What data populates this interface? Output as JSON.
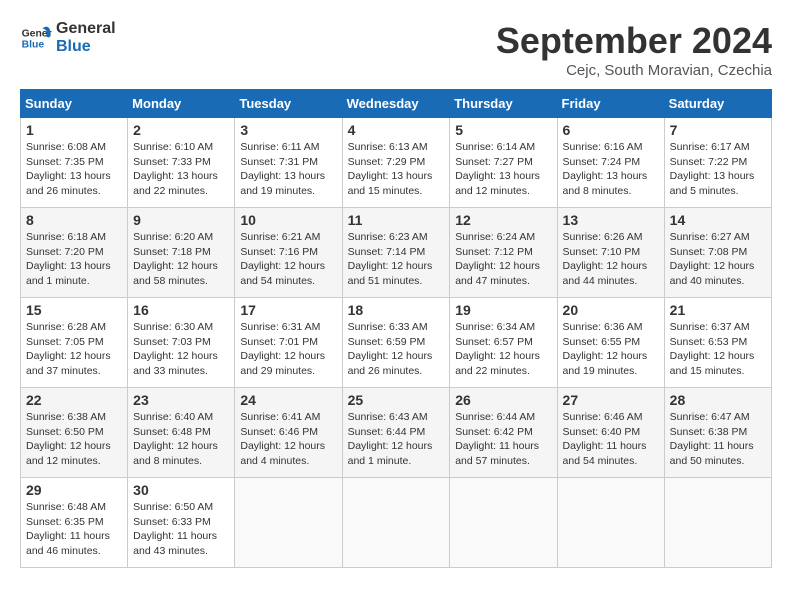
{
  "header": {
    "logo_line1": "General",
    "logo_line2": "Blue",
    "title": "September 2024",
    "location": "Cejc, South Moravian, Czechia"
  },
  "weekdays": [
    "Sunday",
    "Monday",
    "Tuesday",
    "Wednesday",
    "Thursday",
    "Friday",
    "Saturday"
  ],
  "weeks": [
    [
      {
        "day": "1",
        "info": "Sunrise: 6:08 AM\nSunset: 7:35 PM\nDaylight: 13 hours\nand 26 minutes."
      },
      {
        "day": "2",
        "info": "Sunrise: 6:10 AM\nSunset: 7:33 PM\nDaylight: 13 hours\nand 22 minutes."
      },
      {
        "day": "3",
        "info": "Sunrise: 6:11 AM\nSunset: 7:31 PM\nDaylight: 13 hours\nand 19 minutes."
      },
      {
        "day": "4",
        "info": "Sunrise: 6:13 AM\nSunset: 7:29 PM\nDaylight: 13 hours\nand 15 minutes."
      },
      {
        "day": "5",
        "info": "Sunrise: 6:14 AM\nSunset: 7:27 PM\nDaylight: 13 hours\nand 12 minutes."
      },
      {
        "day": "6",
        "info": "Sunrise: 6:16 AM\nSunset: 7:24 PM\nDaylight: 13 hours\nand 8 minutes."
      },
      {
        "day": "7",
        "info": "Sunrise: 6:17 AM\nSunset: 7:22 PM\nDaylight: 13 hours\nand 5 minutes."
      }
    ],
    [
      {
        "day": "8",
        "info": "Sunrise: 6:18 AM\nSunset: 7:20 PM\nDaylight: 13 hours\nand 1 minute."
      },
      {
        "day": "9",
        "info": "Sunrise: 6:20 AM\nSunset: 7:18 PM\nDaylight: 12 hours\nand 58 minutes."
      },
      {
        "day": "10",
        "info": "Sunrise: 6:21 AM\nSunset: 7:16 PM\nDaylight: 12 hours\nand 54 minutes."
      },
      {
        "day": "11",
        "info": "Sunrise: 6:23 AM\nSunset: 7:14 PM\nDaylight: 12 hours\nand 51 minutes."
      },
      {
        "day": "12",
        "info": "Sunrise: 6:24 AM\nSunset: 7:12 PM\nDaylight: 12 hours\nand 47 minutes."
      },
      {
        "day": "13",
        "info": "Sunrise: 6:26 AM\nSunset: 7:10 PM\nDaylight: 12 hours\nand 44 minutes."
      },
      {
        "day": "14",
        "info": "Sunrise: 6:27 AM\nSunset: 7:08 PM\nDaylight: 12 hours\nand 40 minutes."
      }
    ],
    [
      {
        "day": "15",
        "info": "Sunrise: 6:28 AM\nSunset: 7:05 PM\nDaylight: 12 hours\nand 37 minutes."
      },
      {
        "day": "16",
        "info": "Sunrise: 6:30 AM\nSunset: 7:03 PM\nDaylight: 12 hours\nand 33 minutes."
      },
      {
        "day": "17",
        "info": "Sunrise: 6:31 AM\nSunset: 7:01 PM\nDaylight: 12 hours\nand 29 minutes."
      },
      {
        "day": "18",
        "info": "Sunrise: 6:33 AM\nSunset: 6:59 PM\nDaylight: 12 hours\nand 26 minutes."
      },
      {
        "day": "19",
        "info": "Sunrise: 6:34 AM\nSunset: 6:57 PM\nDaylight: 12 hours\nand 22 minutes."
      },
      {
        "day": "20",
        "info": "Sunrise: 6:36 AM\nSunset: 6:55 PM\nDaylight: 12 hours\nand 19 minutes."
      },
      {
        "day": "21",
        "info": "Sunrise: 6:37 AM\nSunset: 6:53 PM\nDaylight: 12 hours\nand 15 minutes."
      }
    ],
    [
      {
        "day": "22",
        "info": "Sunrise: 6:38 AM\nSunset: 6:50 PM\nDaylight: 12 hours\nand 12 minutes."
      },
      {
        "day": "23",
        "info": "Sunrise: 6:40 AM\nSunset: 6:48 PM\nDaylight: 12 hours\nand 8 minutes."
      },
      {
        "day": "24",
        "info": "Sunrise: 6:41 AM\nSunset: 6:46 PM\nDaylight: 12 hours\nand 4 minutes."
      },
      {
        "day": "25",
        "info": "Sunrise: 6:43 AM\nSunset: 6:44 PM\nDaylight: 12 hours\nand 1 minute."
      },
      {
        "day": "26",
        "info": "Sunrise: 6:44 AM\nSunset: 6:42 PM\nDaylight: 11 hours\nand 57 minutes."
      },
      {
        "day": "27",
        "info": "Sunrise: 6:46 AM\nSunset: 6:40 PM\nDaylight: 11 hours\nand 54 minutes."
      },
      {
        "day": "28",
        "info": "Sunrise: 6:47 AM\nSunset: 6:38 PM\nDaylight: 11 hours\nand 50 minutes."
      }
    ],
    [
      {
        "day": "29",
        "info": "Sunrise: 6:48 AM\nSunset: 6:35 PM\nDaylight: 11 hours\nand 46 minutes."
      },
      {
        "day": "30",
        "info": "Sunrise: 6:50 AM\nSunset: 6:33 PM\nDaylight: 11 hours\nand 43 minutes."
      },
      {
        "day": "",
        "info": ""
      },
      {
        "day": "",
        "info": ""
      },
      {
        "day": "",
        "info": ""
      },
      {
        "day": "",
        "info": ""
      },
      {
        "day": "",
        "info": ""
      }
    ]
  ]
}
